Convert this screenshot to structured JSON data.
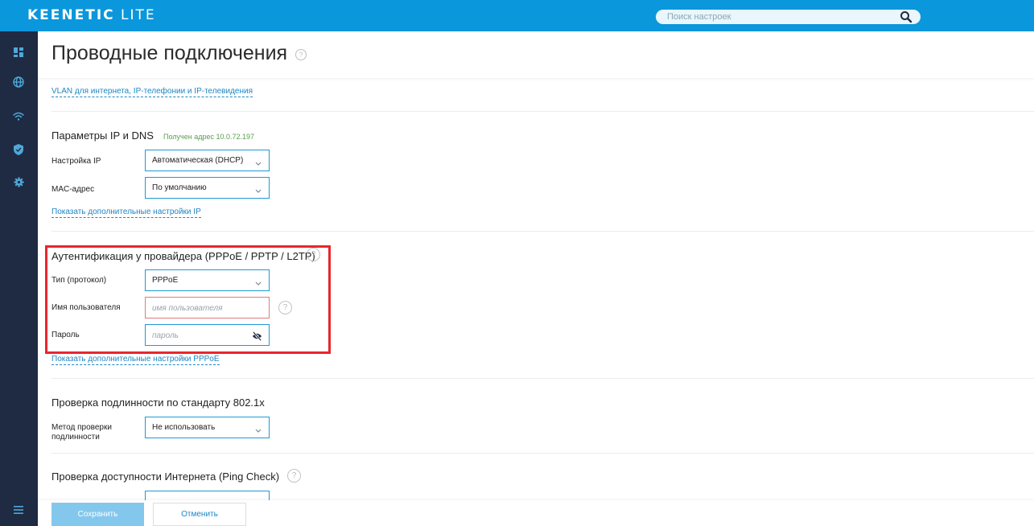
{
  "app": {
    "brand": "KEENETIC",
    "model": "LITE",
    "accent_color": "#0a97dc",
    "sidebar_color": "#1e2b43"
  },
  "search": {
    "placeholder": "Поиск настроек",
    "icon": "search-icon"
  },
  "sidebar": {
    "items": [
      {
        "name": "dashboard",
        "icon": "dashboard-icon",
        "active": false
      },
      {
        "name": "internet",
        "icon": "globe-icon",
        "active": true
      },
      {
        "name": "wifi",
        "icon": "wifi-icon",
        "active": false
      },
      {
        "name": "security",
        "icon": "shield-icon",
        "active": false
      },
      {
        "name": "settings",
        "icon": "gear-icon",
        "active": false
      }
    ],
    "menu_icon": "hamburger-icon"
  },
  "page": {
    "title": "Проводные подключения",
    "help": "?"
  },
  "vlan_link": "VLAN для интернета, IP-телефонии и IP-телевидения",
  "ip_section": {
    "title": "Параметры IP и DNS",
    "note": "Получен адрес 10.0.72.197",
    "ip_label": "Настройка IP",
    "ip_value": "Автоматическая (DHCP)",
    "mac_label": "MAC-адрес",
    "mac_value": "По умолчанию",
    "more_link": "Показать дополнительные настройки IP"
  },
  "auth_section": {
    "title": "Аутентификация у провайдера (PPPoE / PPTP / L2TP)",
    "type_label": "Тип (протокол)",
    "type_value": "PPPoE",
    "user_label": "Имя пользователя",
    "user_placeholder": "имя пользователя",
    "pass_label": "Пароль",
    "pass_placeholder": "пароль",
    "pass_icon": "eye-slash-icon",
    "more_link": "Показать дополнительные настройки PPPoE",
    "highlight_color": "#e8262d"
  },
  "dot1x_section": {
    "title": "Проверка подлинности по стандарту 802.1x",
    "method_label": "Метод проверки подлинности",
    "method_value": "Не использовать"
  },
  "ping_section": {
    "title": "Проверка доступности Интернета (Ping Check)"
  },
  "footer": {
    "save_label": "Сохранить",
    "cancel_label": "Отменить"
  }
}
